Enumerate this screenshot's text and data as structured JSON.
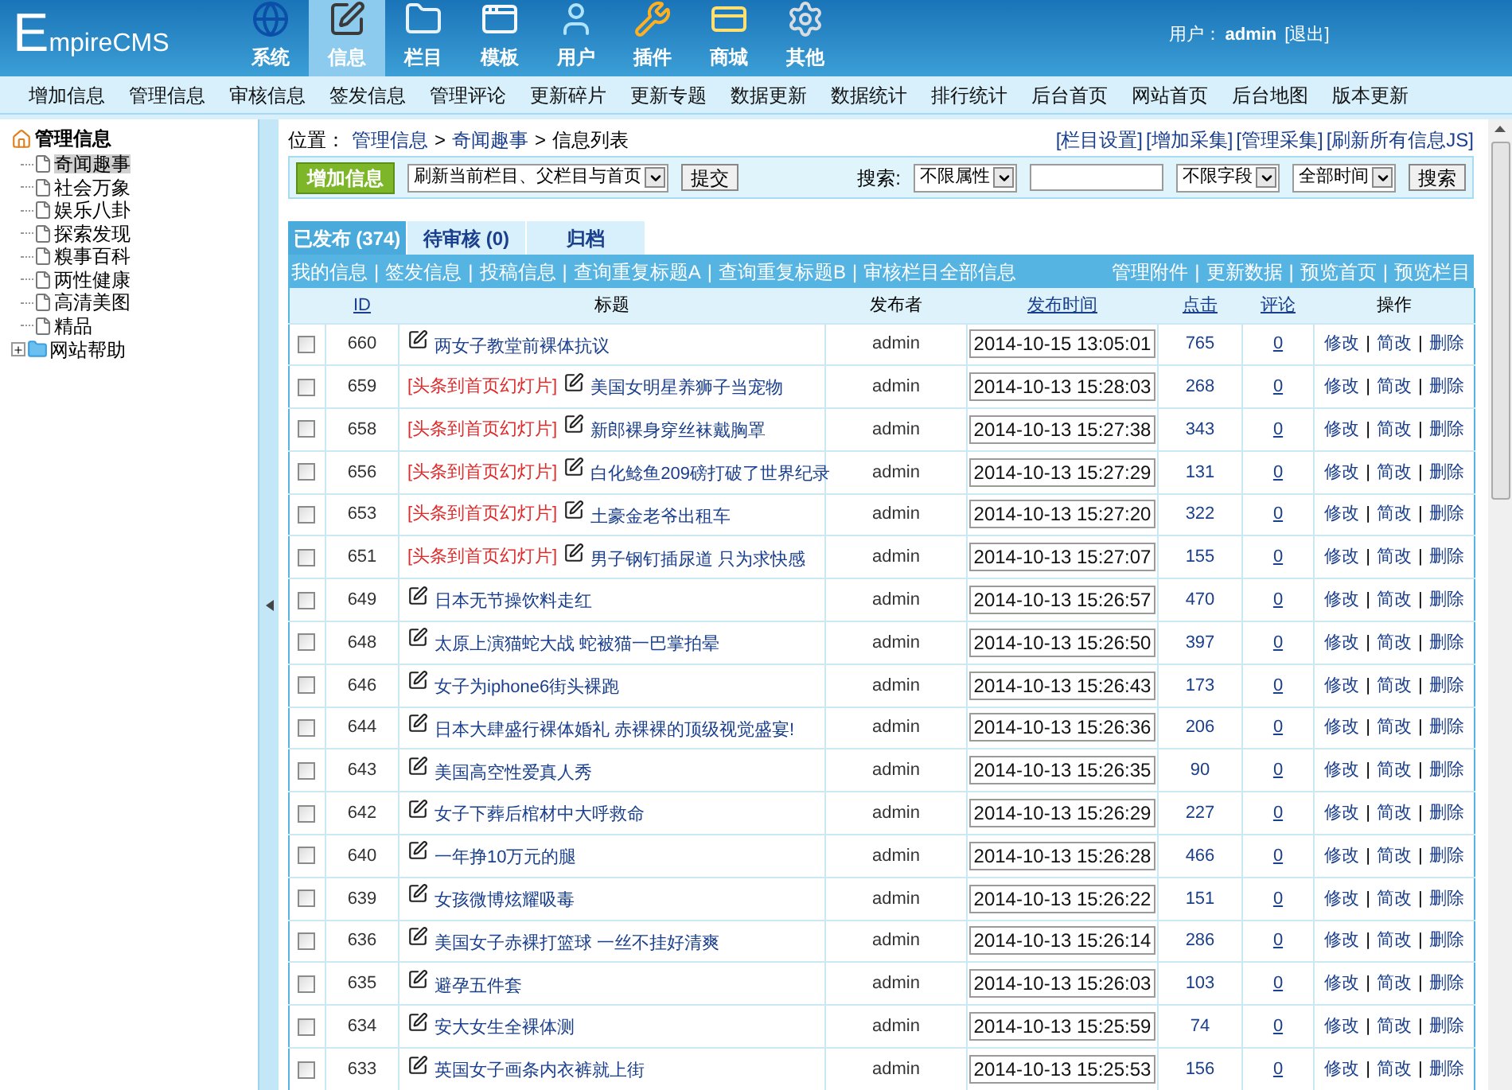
{
  "header": {
    "logo": "EmpireCMS",
    "nav": [
      {
        "label": "系统",
        "selected": false
      },
      {
        "label": "信息",
        "selected": true
      },
      {
        "label": "栏目",
        "selected": false
      },
      {
        "label": "模板",
        "selected": false
      },
      {
        "label": "用户",
        "selected": false
      },
      {
        "label": "插件",
        "selected": false
      },
      {
        "label": "商城",
        "selected": false
      },
      {
        "label": "其他",
        "selected": false
      }
    ],
    "user_label": "用户：",
    "user_name": "admin",
    "logout": "[退出]"
  },
  "menu": [
    "增加信息",
    "管理信息",
    "审核信息",
    "签发信息",
    "管理评论",
    "更新碎片",
    "更新专题",
    "数据更新",
    "数据统计",
    "排行统计",
    "后台首页",
    "网站首页",
    "后台地图",
    "版本更新"
  ],
  "sidebar": {
    "root": "管理信息",
    "items": [
      {
        "label": "奇闻趣事",
        "selected": true
      },
      {
        "label": "社会万象",
        "selected": false
      },
      {
        "label": "娱乐八卦",
        "selected": false
      },
      {
        "label": "探索发现",
        "selected": false
      },
      {
        "label": "糗事百科",
        "selected": false
      },
      {
        "label": "两性健康",
        "selected": false
      },
      {
        "label": "高清美图",
        "selected": false
      },
      {
        "label": "精品",
        "selected": false
      }
    ],
    "folders": [
      {
        "label": "网站帮助",
        "expanded": false
      }
    ]
  },
  "breadcrumb": {
    "label": "位置：",
    "parts": [
      "管理信息",
      "奇闻趣事",
      "信息列表"
    ],
    "separator": ">"
  },
  "top_links": [
    "[栏目设置]",
    "[增加采集]",
    "[管理采集]",
    "[刷新所有信息JS]"
  ],
  "toolbar": {
    "add_button": "增加信息",
    "refresh_select": "刷新当前栏目、父栏目与首页",
    "submit": "提交",
    "search_label": "搜索:",
    "attribute_select": "不限属性",
    "field_select": "不限字段",
    "time_select": "全部时间",
    "search_button": "搜索"
  },
  "tabs": [
    {
      "label": "已发布 (374)",
      "selected": true
    },
    {
      "label": "待审核 (0)",
      "selected": false
    },
    {
      "label": "归档",
      "selected": false
    }
  ],
  "separator": "|",
  "link_bar": {
    "left": [
      "我的信息",
      "签发信息",
      "投稿信息",
      "查询重复标题A",
      "查询重复标题B",
      "审核栏目全部信息"
    ],
    "right": [
      "管理附件",
      "更新数据",
      "预览首页",
      "预览栏目"
    ]
  },
  "columns": [
    {
      "label": "ID",
      "link": true
    },
    {
      "label": "标题",
      "link": false
    },
    {
      "label": "发布者",
      "link": false
    },
    {
      "label": "发布时间",
      "link": true
    },
    {
      "label": "点击",
      "link": true
    },
    {
      "label": "评论",
      "link": true
    },
    {
      "label": "操作",
      "link": false
    }
  ],
  "rows": [
    {
      "checked": false,
      "id": "660",
      "title": "两女子教堂前裸体抗议",
      "author": "admin",
      "time": "2014-10-15 13:05:01",
      "clicks": "765",
      "comments": "0",
      "actions": [
        "修改",
        "简改",
        "删除"
      ]
    },
    {
      "checked": false,
      "id": "659",
      "flag": "[头条到首页幻灯片]",
      "title": "美国女明星养狮子当宠物",
      "author": "admin",
      "time": "2014-10-13 15:28:03",
      "clicks": "268",
      "comments": "0",
      "actions": [
        "修改",
        "简改",
        "删除"
      ]
    },
    {
      "checked": false,
      "id": "658",
      "flag": "[头条到首页幻灯片]",
      "title": "新郎裸身穿丝袜戴胸罩",
      "author": "admin",
      "time": "2014-10-13 15:27:38",
      "clicks": "343",
      "comments": "0",
      "actions": [
        "修改",
        "简改",
        "删除"
      ]
    },
    {
      "checked": false,
      "id": "656",
      "flag": "[头条到首页幻灯片]",
      "title": "白化鲶鱼209磅打破了世界纪录",
      "author": "admin",
      "time": "2014-10-13 15:27:29",
      "clicks": "131",
      "comments": "0",
      "actions": [
        "修改",
        "简改",
        "删除"
      ]
    },
    {
      "checked": false,
      "id": "653",
      "flag": "[头条到首页幻灯片]",
      "title": "土豪金老爷出租车",
      "author": "admin",
      "time": "2014-10-13 15:27:20",
      "clicks": "322",
      "comments": "0",
      "actions": [
        "修改",
        "简改",
        "删除"
      ]
    },
    {
      "checked": false,
      "id": "651",
      "flag": "[头条到首页幻灯片]",
      "title": "男子钢钉插尿道 只为求快感",
      "author": "admin",
      "time": "2014-10-13 15:27:07",
      "clicks": "155",
      "comments": "0",
      "actions": [
        "修改",
        "简改",
        "删除"
      ]
    },
    {
      "checked": false,
      "id": "649",
      "title": "日本无节操饮料走红",
      "author": "admin",
      "time": "2014-10-13 15:26:57",
      "clicks": "470",
      "comments": "0",
      "actions": [
        "修改",
        "简改",
        "删除"
      ]
    },
    {
      "checked": false,
      "id": "648",
      "title": "太原上演猫蛇大战 蛇被猫一巴掌拍晕",
      "author": "admin",
      "time": "2014-10-13 15:26:50",
      "clicks": "397",
      "comments": "0",
      "actions": [
        "修改",
        "简改",
        "删除"
      ]
    },
    {
      "checked": false,
      "id": "646",
      "title": "女子为iphone6街头裸跑",
      "author": "admin",
      "time": "2014-10-13 15:26:43",
      "clicks": "173",
      "comments": "0",
      "actions": [
        "修改",
        "简改",
        "删除"
      ]
    },
    {
      "checked": false,
      "id": "644",
      "title": "日本大肆盛行裸体婚礼 赤裸裸的顶级视觉盛宴!",
      "author": "admin",
      "time": "2014-10-13 15:26:36",
      "clicks": "206",
      "comments": "0",
      "actions": [
        "修改",
        "简改",
        "删除"
      ]
    },
    {
      "checked": false,
      "id": "643",
      "title": "美国高空性爱真人秀",
      "author": "admin",
      "time": "2014-10-13 15:26:35",
      "clicks": "90",
      "comments": "0",
      "actions": [
        "修改",
        "简改",
        "删除"
      ]
    },
    {
      "checked": false,
      "id": "642",
      "title": "女子下葬后棺材中大呼救命",
      "author": "admin",
      "time": "2014-10-13 15:26:29",
      "clicks": "227",
      "comments": "0",
      "actions": [
        "修改",
        "简改",
        "删除"
      ]
    },
    {
      "checked": false,
      "id": "640",
      "title": "一年挣10万元的腿",
      "author": "admin",
      "time": "2014-10-13 15:26:28",
      "clicks": "466",
      "comments": "0",
      "actions": [
        "修改",
        "简改",
        "删除"
      ]
    },
    {
      "checked": false,
      "id": "639",
      "title": "女孩微博炫耀吸毒",
      "author": "admin",
      "time": "2014-10-13 15:26:22",
      "clicks": "151",
      "comments": "0",
      "actions": [
        "修改",
        "简改",
        "删除"
      ]
    },
    {
      "checked": false,
      "id": "636",
      "title": "美国女子赤裸打篮球 一丝不挂好清爽",
      "author": "admin",
      "time": "2014-10-13 15:26:14",
      "clicks": "286",
      "comments": "0",
      "actions": [
        "修改",
        "简改",
        "删除"
      ]
    },
    {
      "checked": false,
      "id": "635",
      "title": "避孕五件套",
      "author": "admin",
      "time": "2014-10-13 15:26:03",
      "clicks": "103",
      "comments": "0",
      "actions": [
        "修改",
        "简改",
        "删除"
      ]
    },
    {
      "checked": false,
      "id": "634",
      "title": "安大女生全裸体测",
      "author": "admin",
      "time": "2014-10-13 15:25:59",
      "clicks": "74",
      "comments": "0",
      "actions": [
        "修改",
        "简改",
        "删除"
      ]
    },
    {
      "checked": false,
      "id": "633",
      "title": "英国女子画条内衣裤就上街",
      "author": "admin",
      "time": "2014-10-13 15:25:53",
      "clicks": "156",
      "comments": "0",
      "actions": [
        "修改",
        "简改",
        "删除"
      ]
    }
  ]
}
